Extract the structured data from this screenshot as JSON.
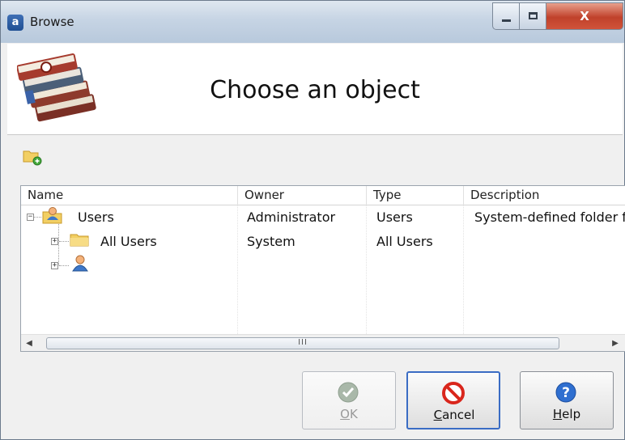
{
  "window": {
    "title": "Browse",
    "app_icon_letter": "a",
    "close_label": "X"
  },
  "header": {
    "heading": "Choose an object",
    "logo_icon": "books-icon"
  },
  "toolbar": {
    "new_folder_icon": "new-folder-icon"
  },
  "list": {
    "columns": [
      "Name",
      "Owner",
      "Type",
      "Description"
    ],
    "rows": [
      {
        "name": "Users",
        "owner": "Administrator",
        "type": "Users",
        "description": "System-defined folder f",
        "icon": "users-folder-icon",
        "level": 0,
        "expander": "−"
      },
      {
        "name": "All Users",
        "owner": "System",
        "type": "All Users",
        "description": "",
        "icon": "folder-icon",
        "level": 1,
        "expander": "+"
      },
      {
        "name": "",
        "owner": "",
        "type": "",
        "description": "",
        "icon": "user-icon",
        "level": 1,
        "expander": "+"
      }
    ],
    "scroll_thumb_grip": "III"
  },
  "buttons": {
    "ok": {
      "label_mnemonic": "O",
      "label_rest": "K",
      "enabled": false
    },
    "cancel": {
      "label_mnemonic": "C",
      "label_rest": "ancel"
    },
    "help": {
      "label_mnemonic": "H",
      "label_rest": "elp"
    }
  },
  "colors": {
    "accent": "#3a6cc4",
    "cancel_red": "#d9261c",
    "ok_green": "#8fa98f",
    "help_blue": "#2f6fd0"
  }
}
